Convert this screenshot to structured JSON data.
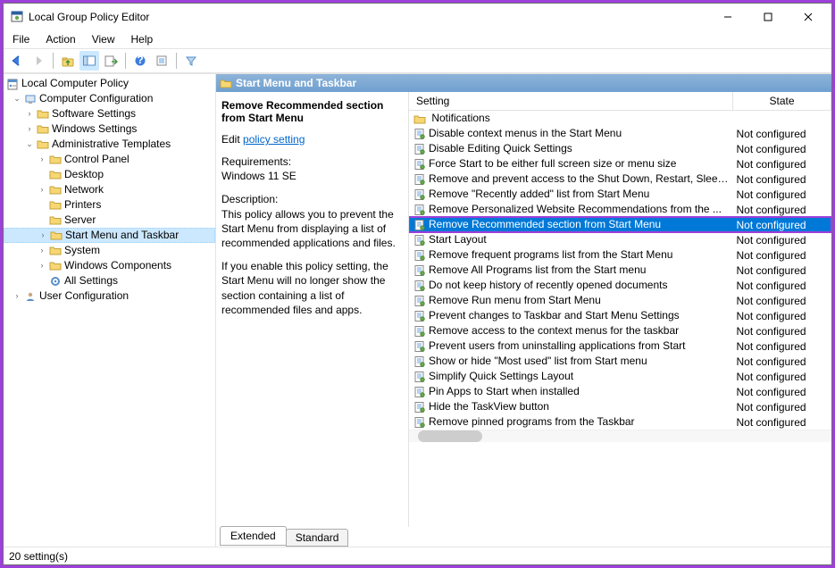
{
  "window": {
    "title": "Local Group Policy Editor",
    "status": "20 setting(s)"
  },
  "menubar": [
    "File",
    "Action",
    "View",
    "Help"
  ],
  "tabs": {
    "extended": "Extended",
    "standard": "Standard"
  },
  "tree": {
    "root": "Local Computer Policy",
    "cc": "Computer Configuration",
    "sw": "Software Settings",
    "wn": "Windows Settings",
    "at": "Administrative Templates",
    "cp": "Control Panel",
    "dk": "Desktop",
    "nw": "Network",
    "pr": "Printers",
    "sv": "Server",
    "sm": "Start Menu and Taskbar",
    "sy": "System",
    "wc": "Windows Components",
    "as": "All Settings",
    "uc": "User Configuration"
  },
  "header": {
    "title": "Start Menu and Taskbar"
  },
  "detail": {
    "title": "Remove Recommended section from Start Menu",
    "edit_label": "Edit",
    "link": "policy setting",
    "req_label": "Requirements:",
    "req": "Windows 11 SE",
    "desc_label": "Description:",
    "desc1": "This policy allows you to prevent the Start Menu from displaying a list of recommended applications and files.",
    "desc2": "If you enable this policy setting, the Start Menu will no longer show the section containing a list of recommended files and apps."
  },
  "cols": {
    "setting": "Setting",
    "state": "State"
  },
  "notifications_folder": "Notifications",
  "settings": [
    {
      "s": "Disable context menus in the Start Menu",
      "st": "Not configured"
    },
    {
      "s": "Disable Editing Quick Settings",
      "st": "Not configured"
    },
    {
      "s": "Force Start to be either full screen size or menu size",
      "st": "Not configured"
    },
    {
      "s": "Remove and prevent access to the Shut Down, Restart, Sleep...",
      "st": "Not configured"
    },
    {
      "s": "Remove \"Recently added\" list from Start Menu",
      "st": "Not configured"
    },
    {
      "s": "Remove Personalized Website Recommendations from the ...",
      "st": "Not configured"
    },
    {
      "s": "Remove Recommended section from Start Menu",
      "st": "Not configured",
      "sel": true
    },
    {
      "s": "Start Layout",
      "st": "Not configured"
    },
    {
      "s": "Remove frequent programs list from the Start Menu",
      "st": "Not configured"
    },
    {
      "s": "Remove All Programs list from the Start menu",
      "st": "Not configured"
    },
    {
      "s": "Do not keep history of recently opened documents",
      "st": "Not configured"
    },
    {
      "s": "Remove Run menu from Start Menu",
      "st": "Not configured"
    },
    {
      "s": "Prevent changes to Taskbar and Start Menu Settings",
      "st": "Not configured"
    },
    {
      "s": "Remove access to the context menus for the taskbar",
      "st": "Not configured"
    },
    {
      "s": "Prevent users from uninstalling applications from Start",
      "st": "Not configured"
    },
    {
      "s": "Show or hide \"Most used\" list from Start menu",
      "st": "Not configured"
    },
    {
      "s": "Simplify Quick Settings Layout",
      "st": "Not configured"
    },
    {
      "s": "Pin Apps to Start when installed",
      "st": "Not configured"
    },
    {
      "s": "Hide the TaskView button",
      "st": "Not configured"
    },
    {
      "s": "Remove pinned programs from the Taskbar",
      "st": "Not configured"
    }
  ]
}
